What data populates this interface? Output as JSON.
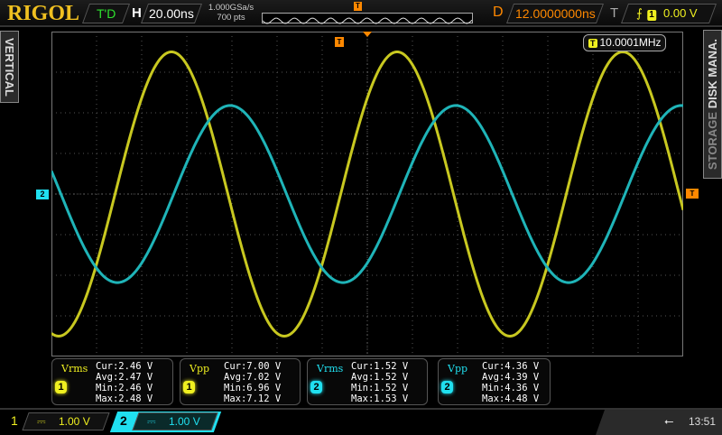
{
  "header": {
    "logo": "RIGOL",
    "run_state": "T'D",
    "h_label": "H",
    "timebase": "20.00ns",
    "sample_rate": "1.000GSa/s",
    "memory_depth": "700  pts",
    "delay_label": "D",
    "delay": "12.0000000ns",
    "trigger_label": "T",
    "trigger_source": "1",
    "trigger_level": "0.00 V"
  },
  "side_tabs": {
    "left": "VERTICAL",
    "right_1": "DISK MANA.",
    "right_2": "STORAGE"
  },
  "markers": {
    "trigger_top": "T",
    "trigger_right": "T",
    "ch2_ground": "2"
  },
  "frequency_readout": {
    "icon": "T",
    "value": "10.0001MHz"
  },
  "colors": {
    "ch1": "#d8d820",
    "ch2": "#20c0c8",
    "accent": "#ff8800"
  },
  "waveforms": {
    "time_per_div_ns": 20,
    "volts_per_div": 1,
    "ch1": {
      "freq_mhz": 10.0001,
      "vpp": 7.0,
      "peak_time_ns": -86.8
    },
    "ch2": {
      "freq_mhz": 10.0001,
      "vpp": 4.36,
      "peak_time_ns": -60.8
    }
  },
  "measurements": [
    {
      "channel": "1",
      "type": "Vrms",
      "cur": "Cur:2.46 V",
      "avg": "Avg:2.47 V",
      "min": "Min:2.46 V",
      "max": "Max:2.48 V"
    },
    {
      "channel": "1",
      "type": "Vpp",
      "cur": "Cur:7.00 V",
      "avg": "Avg:7.02 V",
      "min": "Min:6.96 V",
      "max": "Max:7.12 V"
    },
    {
      "channel": "2",
      "type": "Vrms",
      "cur": "Cur:1.52 V",
      "avg": "Avg:1.52 V",
      "min": "Min:1.52 V",
      "max": "Max:1.53 V"
    },
    {
      "channel": "2",
      "type": "Vpp",
      "cur": "Cur:4.36 V",
      "avg": "Avg:4.39 V",
      "min": "Min:4.36 V",
      "max": "Max:4.48 V"
    }
  ],
  "footer": {
    "ch1_num": "1",
    "ch1_coupling": "⎓",
    "ch1_scale": "1.00 V",
    "ch2_num": "2",
    "ch2_coupling": "⎓",
    "ch2_scale": "1.00 V",
    "usb_icon": "usb",
    "time": "13:51"
  }
}
